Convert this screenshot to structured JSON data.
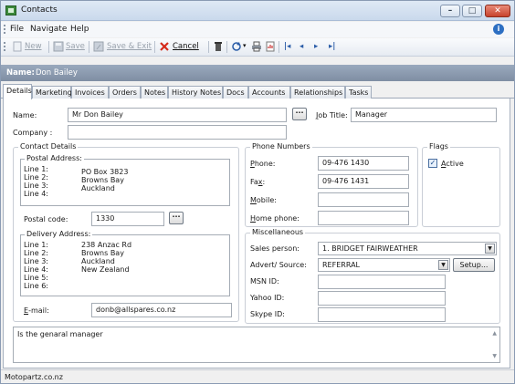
{
  "window": {
    "title": "Contacts"
  },
  "menu": {
    "items": [
      "File",
      "Navigate",
      "Help"
    ]
  },
  "toolbar": {
    "new_label": "New",
    "save_label": "Save",
    "save_exit_label": "Save & Exit",
    "cancel_label": "Cancel"
  },
  "record": {
    "name_label": "Name:",
    "name_value": "Don Bailey"
  },
  "tabs": [
    "Details",
    "Marketing",
    "Invoices",
    "Orders",
    "Notes",
    "History Notes",
    "Docs",
    "Accounts",
    "Relationships",
    "Tasks"
  ],
  "details": {
    "name_label": "Name:",
    "name_value": "Mr Don Bailey",
    "job_title_label": "Job Title:",
    "job_title_value": "Manager",
    "company_label": "Company :",
    "company_value": "",
    "contact_details_title": "Contact Details",
    "postal_title": "Postal Address:",
    "postal_line_labels": [
      "Line 1:",
      "Line 2:",
      "Line 3:",
      "Line 4:"
    ],
    "postal_lines": [
      "PO Box 3823",
      "Browns Bay",
      "Auckland",
      ""
    ],
    "postal_code_label": "Postal code:",
    "postal_code_value": "1330",
    "delivery_title": "Delivery Address:",
    "delivery_line_labels": [
      "Line 1:",
      "Line 2:",
      "Line 3:",
      "Line 4:",
      "Line 5:",
      "Line 6:"
    ],
    "delivery_lines": [
      "238 Anzac Rd",
      "Browns Bay",
      "Auckland",
      "New Zealand",
      "",
      ""
    ],
    "email_label": "E-mail:",
    "email_value": "donb@allspares.co.nz",
    "phone_title": "Phone Numbers",
    "phone_label": "Phone:",
    "phone_value": "09-476 1430",
    "fax_label": "Fax:",
    "fax_value": "09-476 1431",
    "mobile_label": "Mobile:",
    "mobile_value": "",
    "home_phone_label": "Home phone:",
    "home_phone_value": "",
    "flags_title": "Flags",
    "active_label": "Active",
    "active_checked": true,
    "misc_title": "Miscellaneous",
    "sales_person_label": "Sales person:",
    "sales_person_value": "1. BRIDGET FAIRWEATHER",
    "advert_label": "Advert/ Source:",
    "advert_value": "REFERRAL",
    "setup_label": "Setup...",
    "msn_label": "MSN ID:",
    "msn_value": "",
    "yahoo_label": "Yahoo ID:",
    "yahoo_value": "",
    "skype_label": "Skype ID:",
    "skype_value": "",
    "notes_text": "Is the genaral manager"
  },
  "status": {
    "text": "Motopartz.co.nz"
  }
}
